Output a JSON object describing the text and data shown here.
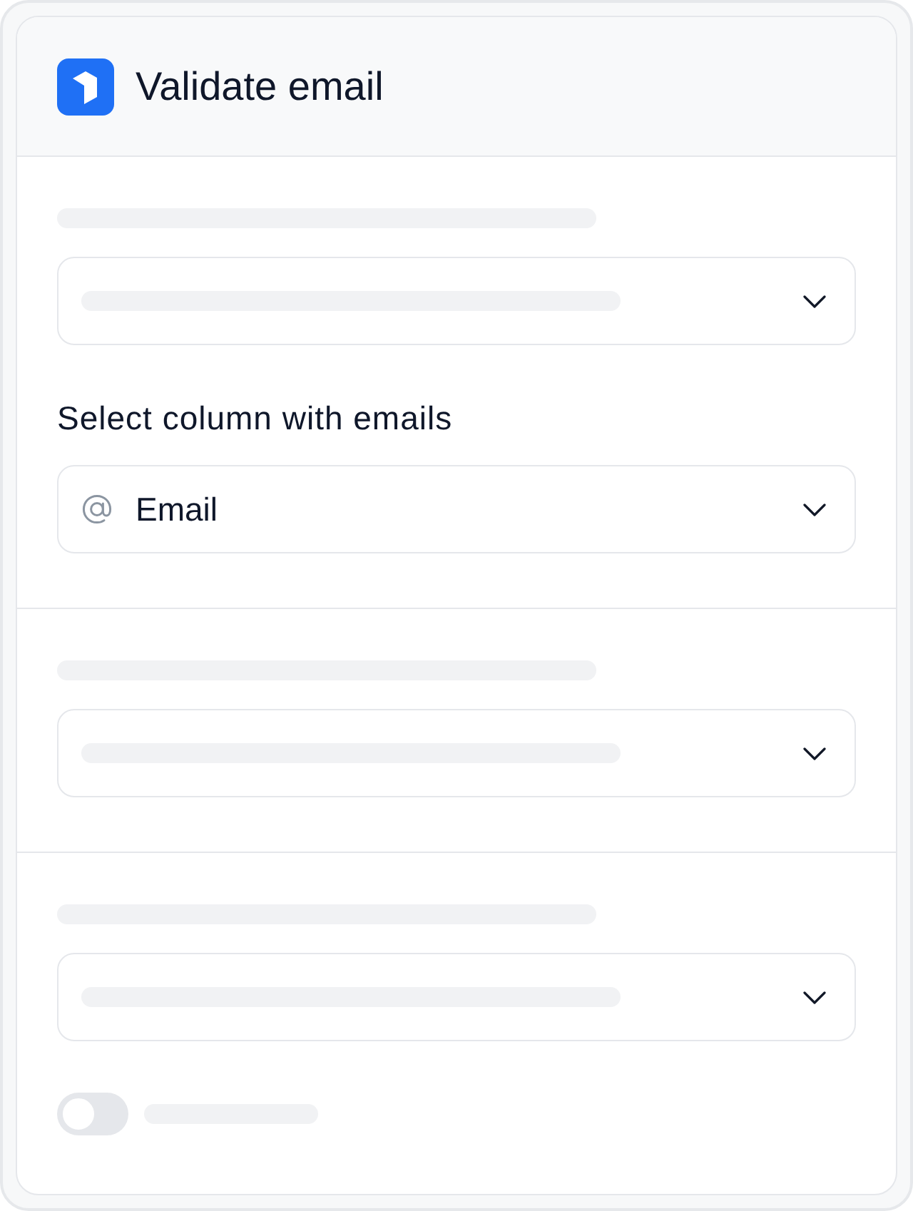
{
  "header": {
    "title": "Validate email"
  },
  "sections": [
    {
      "fields": [
        {
          "kind": "placeholder_select"
        },
        {
          "kind": "select",
          "label": "Select column with emails",
          "value": "Email"
        }
      ]
    },
    {
      "fields": [
        {
          "kind": "placeholder_select"
        }
      ]
    },
    {
      "fields": [
        {
          "kind": "placeholder_select"
        },
        {
          "kind": "placeholder_toggle",
          "on": false
        }
      ]
    }
  ]
}
